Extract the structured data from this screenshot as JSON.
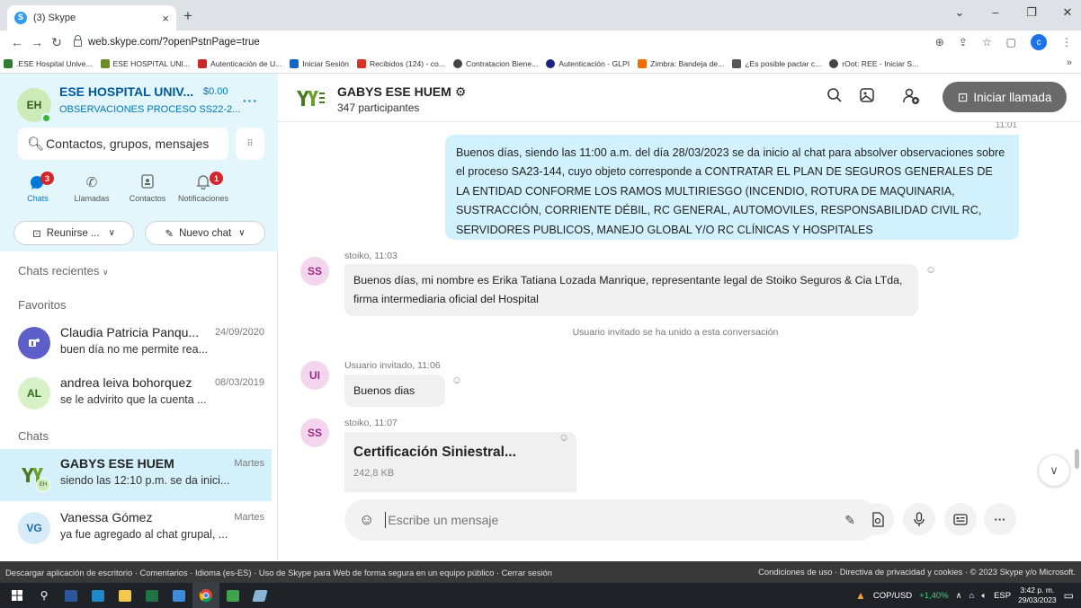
{
  "browser": {
    "tab_title": "(3) Skype",
    "url": "web.skype.com/?openPstnPage=true",
    "bookmarks": [
      {
        "label": ".ESE Hospital Unive...",
        "color": "#2e7d32"
      },
      {
        "label": "ESE HOSPITAL UNI...",
        "color": "#6b8e23"
      },
      {
        "label": "Autenticación de U...",
        "color": "#c62828"
      },
      {
        "label": "Iniciar Sesión",
        "color": "#1565c0"
      },
      {
        "label": "Recibidos (124) - co...",
        "color": "#d93025"
      },
      {
        "label": "Contratacion Biene...",
        "color": "#444444"
      },
      {
        "label": "Autenticación - GLPI",
        "color": "#1a237e"
      },
      {
        "label": "Zimbra: Bandeja de...",
        "color": "#ef6c00"
      },
      {
        "label": "¿Es posible pactar c...",
        "color": "#555555"
      },
      {
        "label": "rOot: REE - Iniciar S...",
        "color": "#444444"
      }
    ]
  },
  "profile": {
    "initials": "EH",
    "name": "ESE HOSPITAL UNIV...",
    "credit": "$0.00",
    "status": "OBSERVACIONES PROCESO SS22-2..."
  },
  "search": {
    "placeholder": "Contactos, grupos, mensajes"
  },
  "nav": [
    {
      "label": "Chats",
      "badge": "3"
    },
    {
      "label": "Llamadas"
    },
    {
      "label": "Contactos"
    },
    {
      "label": "Notificaciones",
      "badge": "1"
    }
  ],
  "actions": {
    "meet": "Reunirse ...",
    "new_chat": "Nuevo chat"
  },
  "sections": {
    "recent": "Chats recientes",
    "favorites": "Favoritos",
    "chats": "Chats"
  },
  "favorites": [
    {
      "name": "Claudia Patricia Panqu...",
      "date": "24/09/2020",
      "preview": "buen día no me permite rea..."
    },
    {
      "initials": "AL",
      "name": "andrea leiva bohorquez",
      "date": "08/03/2019",
      "preview": "se le advirito que la cuenta ..."
    }
  ],
  "chats": [
    {
      "name": "GABYS ESE HUEM",
      "date": "Martes",
      "preview": "siendo las 12:10 p.m. se da inici...",
      "mini_initials": "EH"
    },
    {
      "initials": "VG",
      "name": "Vanessa Gómez",
      "date": "Martes",
      "preview": "ya fue agregado al chat grupal, ..."
    }
  ],
  "header": {
    "group_name": "GABYS ESE HUEM",
    "participants": "347 participantes",
    "call_label": "Iniciar llamada"
  },
  "messages": {
    "own_time": "11:01",
    "own_text": "Buenos días, siendo las 11:00 a.m. del día 28/03/2023 se da inicio al chat para absolver observaciones sobre el proceso SA23-144, cuyo objeto corresponde a CONTRATAR EL PLAN DE SEGUROS GENERALES DE LA ENTIDAD CONFORME LOS RAMOS MULTIRIESGO (INCENDIO, ROTURA DE MAQUINARIA, SUSTRACCIÓN, CORRIENTE DÉBIL, RC GENERAL, AUTOMOVILES, RESPONSABILIDAD CIVIL RC, SERVIDORES PUBLICOS, MANEJO GLOBAL Y/O RC CLÍNICAS Y HOSPITALES",
    "m1_initials": "SS",
    "m1_sender": "stoiko, 11:03",
    "m1_text": "Buenos días, mi nombre es Erika Tatiana Lozada Manrique, representante legal de Stoiko Seguros & Cia LTda, firma intermediaria oficial del Hospital",
    "system": "Usuario invitado se ha unido a esta conversación",
    "m2_initials": "UI",
    "m2_sender": "Usuario invitado, 11:06",
    "m2_text": "Buenos dias",
    "m3_initials": "SS",
    "m3_sender": "stoiko, 11:07",
    "file_name": "Certificación Siniestral...",
    "file_size": "242,8 KB"
  },
  "composer": {
    "placeholder": "Escribe un mensaje"
  },
  "footer": {
    "left": "Descargar aplicación de escritorio · Comentarios · Idioma (es-ES) · Uso de Skype para Web de forma segura en un equipo público · Cerrar sesión",
    "right": "Condiciones de uso · Directiva de privacidad y cookies · © 2023 Skype y/o Microsoft."
  },
  "taskbar": {
    "ticker": "COP/USD",
    "ticker_change": "+1,40%",
    "lang": "ESP",
    "time": "3:42 p. m.",
    "date": "29/03/2023"
  },
  "colors": {
    "accent": "#0078d4",
    "own_bubble": "#d1f1fd",
    "sidebar_top": "#e2f6fc",
    "badge": "#d8232a"
  }
}
